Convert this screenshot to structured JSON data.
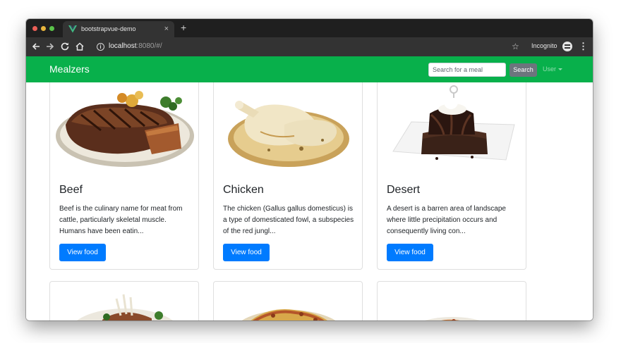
{
  "browser": {
    "tab_title": "bootstrapvue-demo",
    "tab_close": "×",
    "new_tab": "+",
    "url_host": "localhost",
    "url_rest": ":8080/#/",
    "incognito_label": "Incognito",
    "icons": {
      "back": "arrow-left-icon",
      "forward": "arrow-right-icon",
      "reload": "reload-icon",
      "home": "home-icon",
      "info": "info-icon",
      "star": "star-icon",
      "incognito": "incognito-icon",
      "menu": "kebab-menu-icon"
    }
  },
  "app": {
    "brand": "Mealzers",
    "search_placeholder": "Search for a meal",
    "search_button": "Search",
    "user_menu": "User",
    "colors": {
      "navbar": "#08b04b",
      "primary_button": "#007bff",
      "search_button": "#6c757d"
    }
  },
  "meals": [
    {
      "title": "Beef",
      "text": "Beef is the culinary name for meat from cattle, particularly skeletal muscle. Humans have been eatin...",
      "button": "View food"
    },
    {
      "title": "Chicken",
      "text": "The chicken (Gallus gallus domesticus) is a type of domesticated fowl, a subspecies of the red jungl...",
      "button": "View food"
    },
    {
      "title": "Desert",
      "text": "A desert is a barren area of landscape where little precipitation occurs and consequently living con...",
      "button": "View food"
    }
  ]
}
